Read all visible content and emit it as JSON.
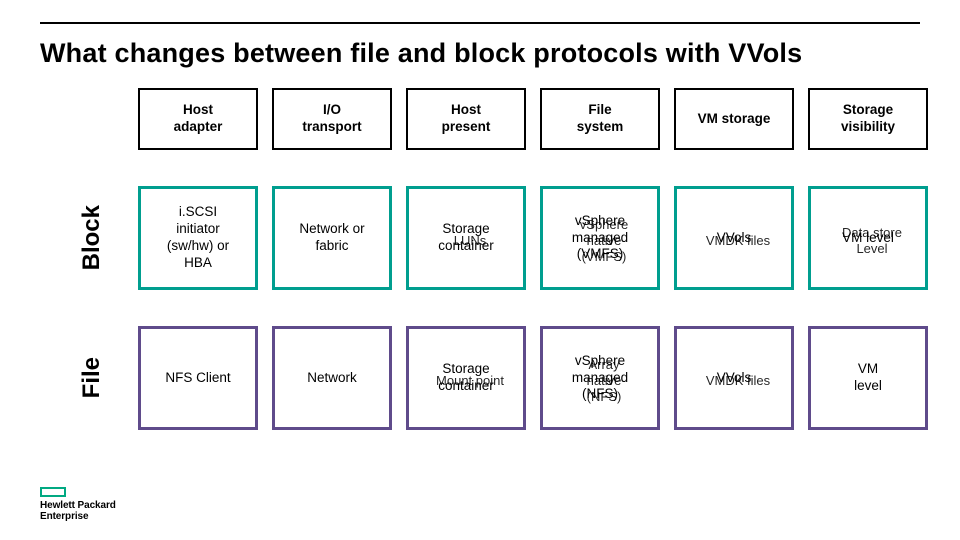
{
  "title": "What changes between file and block protocols with VVols",
  "columns": [
    "Host\nadapter",
    "I/O\ntransport",
    "Host\npresent",
    "File\nsystem",
    "VM storage",
    "Storage\nvisibility"
  ],
  "rows": {
    "block": {
      "label": "Block",
      "cells": [
        {
          "front": "i.SCSI\ninitiator\n(sw/hw) or\nHBA"
        },
        {
          "front": "Network or\nfabric"
        },
        {
          "front": "Storage\ncontainer",
          "back": "LUNs"
        },
        {
          "front": "vSphere\nmanaged\n(VMFS)",
          "back": "vSphere\nnative\n(VMFS)"
        },
        {
          "front": "VVols",
          "back": "VMDK files"
        },
        {
          "front": "VM level",
          "back": "Data store\nLevel"
        }
      ]
    },
    "file": {
      "label": "File",
      "cells": [
        {
          "front": "NFS Client"
        },
        {
          "front": "Network"
        },
        {
          "front": "Storage\ncontainer",
          "back": "Mount point"
        },
        {
          "front": "vSphere\nmanaged\n(NFS)",
          "back": "Array\nnative\n(NFS)"
        },
        {
          "front": "VVols",
          "back": "VMDK files"
        },
        {
          "front": "VM\nlevel"
        }
      ]
    }
  },
  "brand": "Hewlett Packard\nEnterprise",
  "colors": {
    "block": "#009e8f",
    "file": "#5f4b8b",
    "accent": "#01a982"
  }
}
